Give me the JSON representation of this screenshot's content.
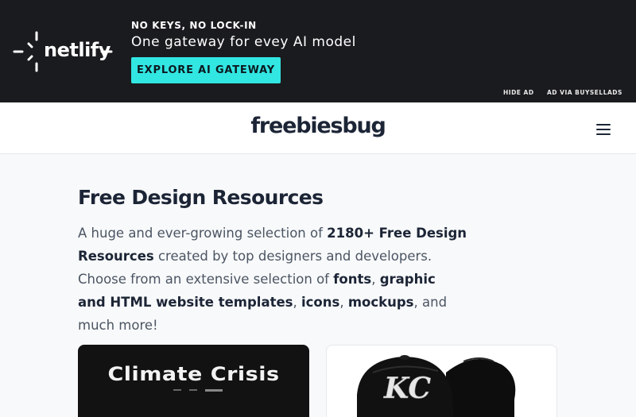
{
  "ad": {
    "logo_text": "netlify",
    "kicker": "NO KEYS, NO LOCK-IN",
    "headline": "One gateway for evey AI model",
    "cta_label": "EXPLORE AI GATEWAY",
    "hide_label": "HIDE AD",
    "via_label": "AD VIA BUYSELLADS",
    "colors": {
      "background": "#1a1b1e",
      "cta": "#32e6e2"
    }
  },
  "header": {
    "brand": "freebiesbug",
    "menu_icon": "hamburger-menu-icon"
  },
  "intro": {
    "title": "Free Design Resources",
    "text": {
      "t1": "A huge and ever-growing selection of ",
      "b1": "2180+ Free Design Resources",
      "t2": " created by top designers and developers. Choose from an extensive selection of ",
      "b2": "fonts",
      "t3": ", ",
      "b3": "graphic and HTML website templates",
      "t4": ", ",
      "b4": "icons",
      "t5": ", ",
      "b5": "mockups",
      "t6": ", and much more!"
    }
  },
  "cards": [
    {
      "title": "Climate Crisis"
    },
    {
      "image": "baseball-cap-mockup-image"
    }
  ]
}
